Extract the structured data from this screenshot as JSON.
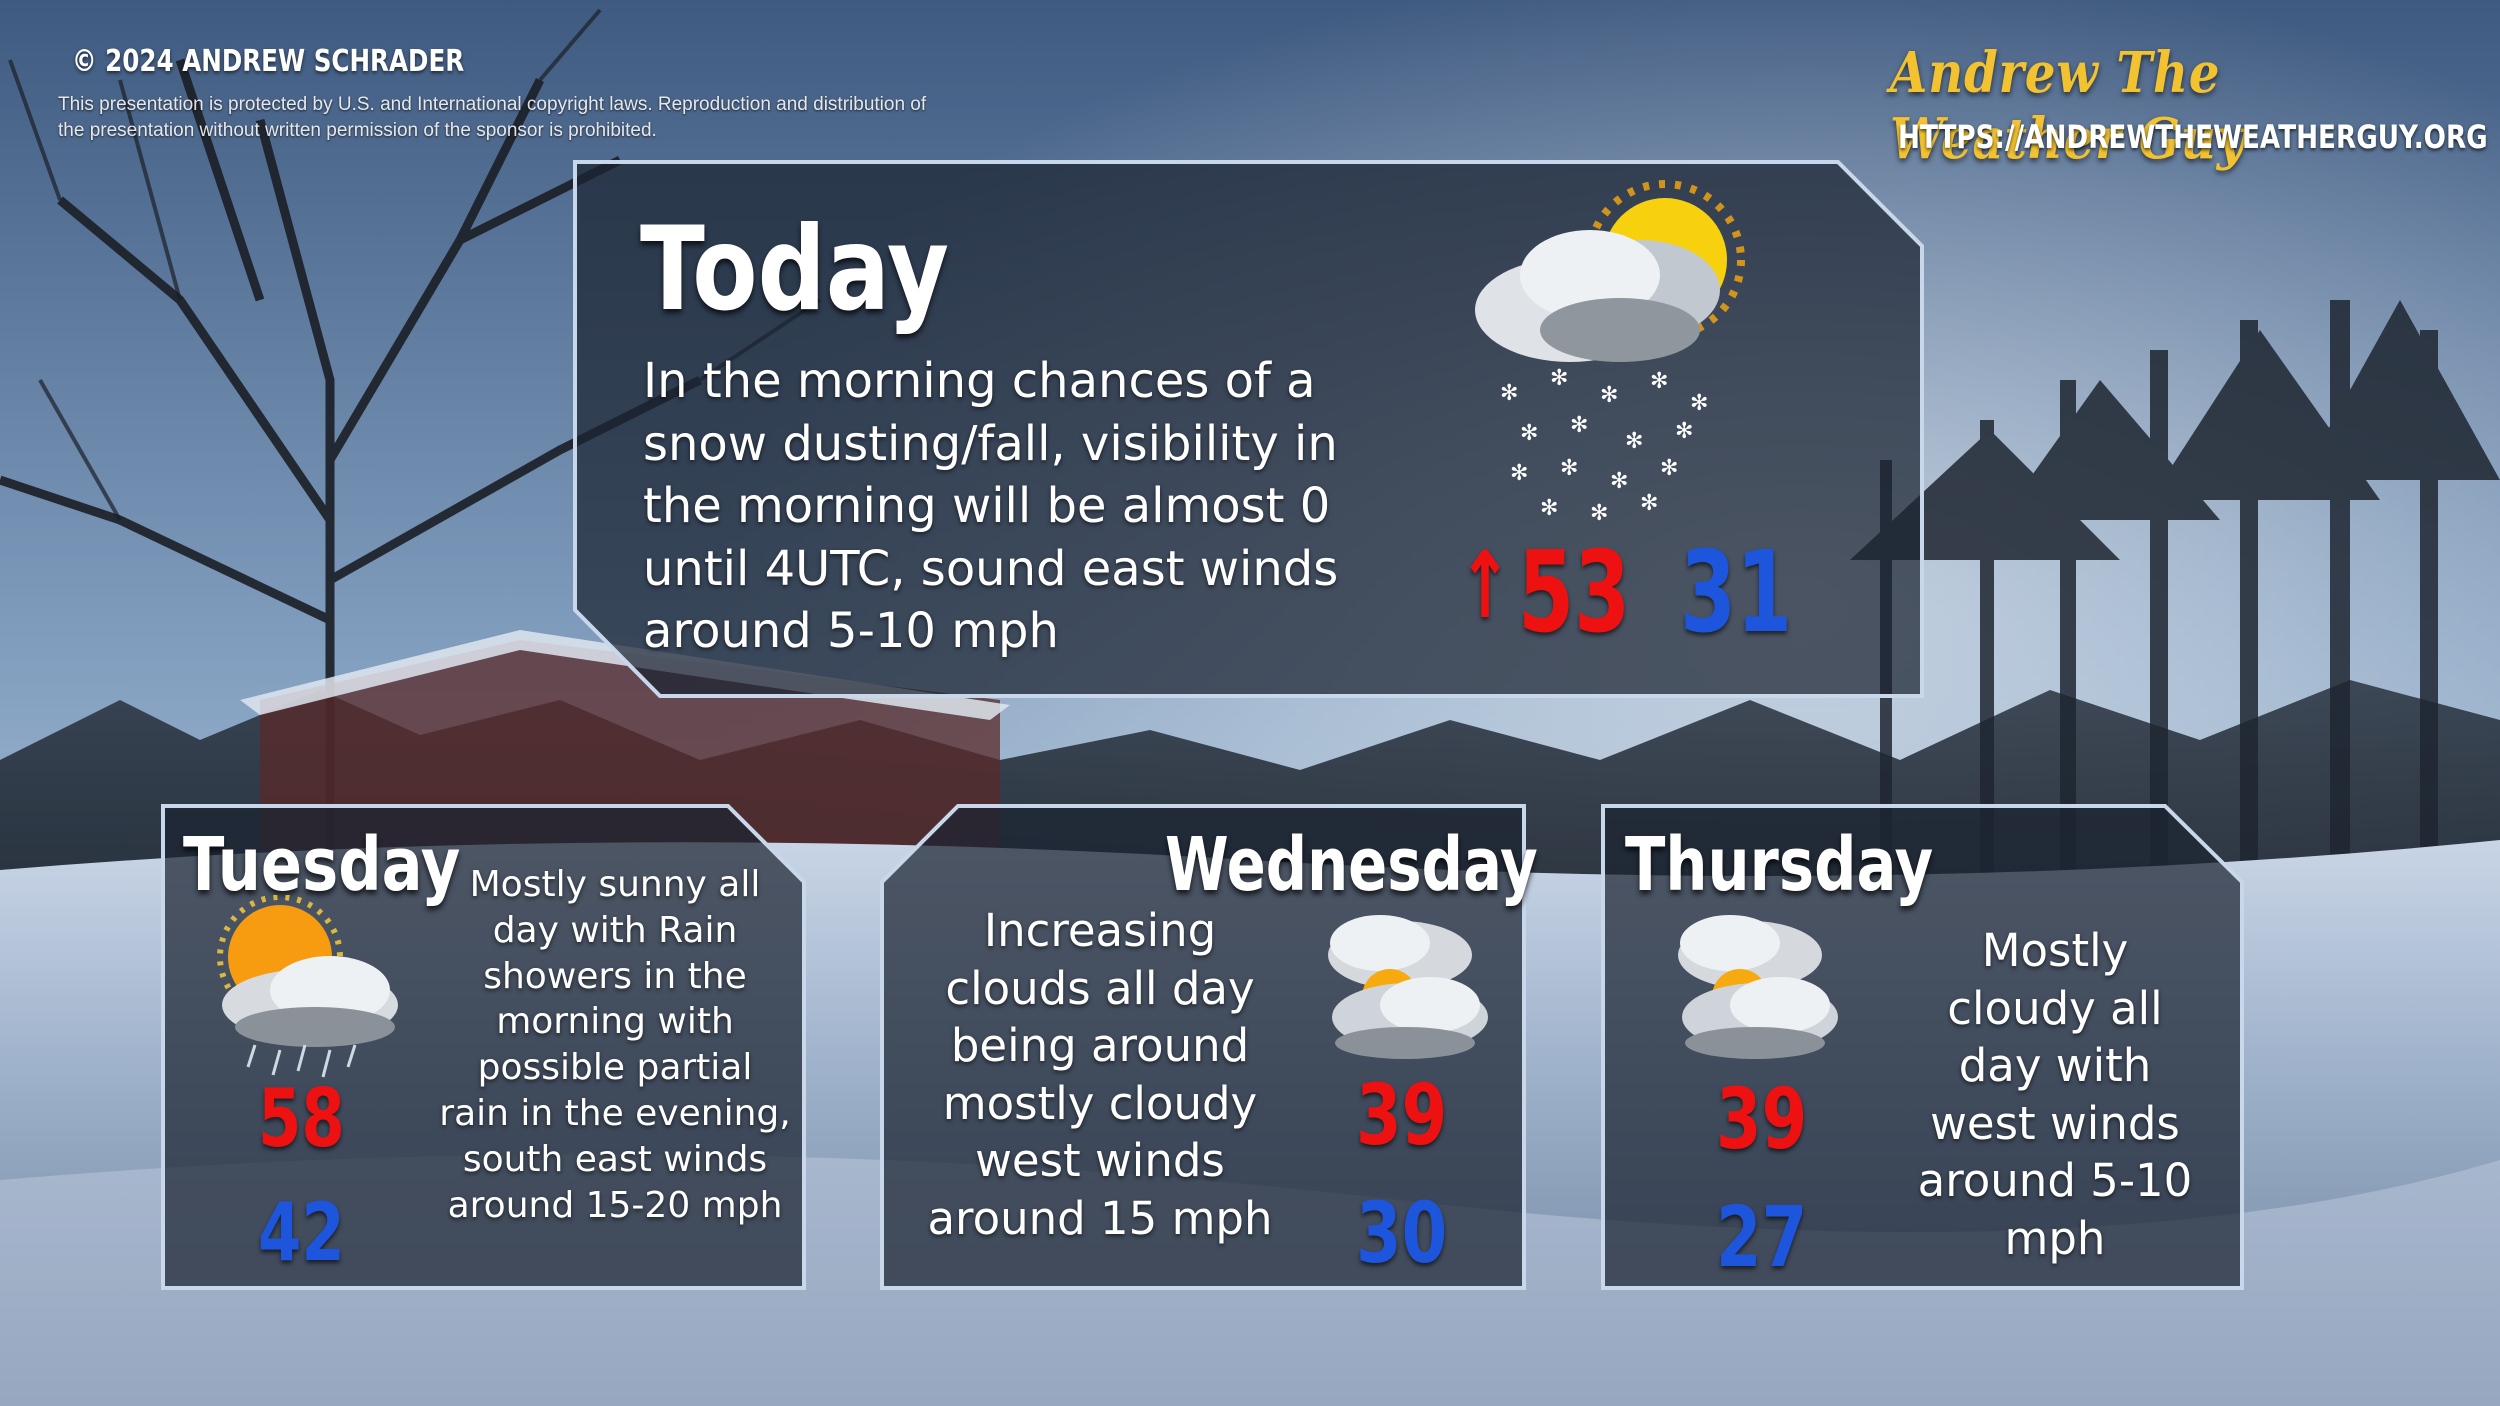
{
  "header": {
    "copyright": "© 2024 ANDREW SCHRADER",
    "legal_line1": "This presentation is protected by U.S. and International copyright laws. Reproduction and distribution of",
    "legal_line2": "the presentation without written permission of the sponsor is prohibited."
  },
  "brand": {
    "name": "Andrew The Weather Guy",
    "url": "HTTPS://ANDREWTHEWEATHERGUY.ORG"
  },
  "today": {
    "title": "Today",
    "description_lines": [
      "In the morning chances of a",
      "snow dusting/fall, visibility in",
      "the  morning will be almost 0",
      "until 4UTC, sound east winds",
      "around 5-10 mph"
    ],
    "high": "53",
    "low": "31",
    "icon": "snow-sun-icon"
  },
  "tuesday": {
    "title": "Tuesday",
    "description_lines": [
      "Mostly sunny all",
      "day with Rain",
      "showers in the",
      "morning with",
      "possible partial",
      "rain in the evening,",
      "south east winds",
      "around 15-20 mph"
    ],
    "high": "58",
    "low": "42",
    "icon": "sun-rain-cloud-icon"
  },
  "wednesday": {
    "title": "Wednesday",
    "description_lines": [
      "Increasing",
      "clouds all day",
      "being around",
      "mostly cloudy",
      "west winds",
      "around 15 mph"
    ],
    "high": "39",
    "low": "30",
    "icon": "mostly-cloudy-icon"
  },
  "thursday": {
    "title": "Thursday",
    "description_lines": [
      "Mostly",
      "cloudy all",
      "day with",
      "west winds",
      "around 5-10",
      "mph"
    ],
    "high": "39",
    "low": "27",
    "icon": "mostly-cloudy-icon"
  },
  "colors": {
    "high": "#ee1111",
    "low": "#1e55dd",
    "brand": "#f2c230",
    "panel_border": "#c9d7ea"
  }
}
